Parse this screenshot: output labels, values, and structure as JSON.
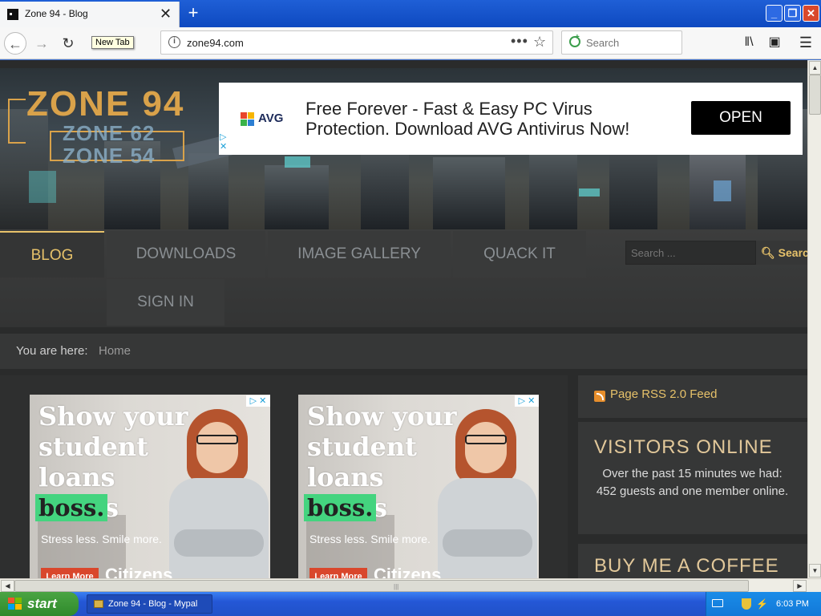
{
  "browser": {
    "tab_title": "Zone 94 - Blog",
    "tooltip": "New Tab",
    "url": "zone94.com",
    "search_placeholder": "Search"
  },
  "site": {
    "logo_main": "ZONE 94",
    "logo_sub1": "ZONE 62",
    "logo_sub2": "ZONE 54",
    "menu": [
      "BLOG",
      "DOWNLOADS",
      "IMAGE GALLERY",
      "QUACK IT",
      "SIGN IN"
    ],
    "active_menu": "BLOG",
    "search_placeholder": "Search ...",
    "search_button": "Search",
    "breadcrumb_label": "You are here:",
    "breadcrumb_home": "Home"
  },
  "top_ad": {
    "brand": "AVG",
    "text": "Free Forever - Fast & Easy PC Virus Protection. Download AVG Antivirus Now!",
    "button": "OPEN"
  },
  "student_ad": {
    "headline": "Show your student loans who's",
    "highlight": "boss.",
    "subline": "Stress less. Smile more.",
    "cta": "Learn More",
    "brand": "Citizens"
  },
  "sidebar": {
    "rss_label": "Page RSS 2.0 Feed",
    "visitors_title": "VISITORS ONLINE",
    "visitors_text": "Over the past 15 minutes we had: 452 guests and one member online.",
    "coffee_title": "BUY ME A COFFEE"
  },
  "taskbar": {
    "start_label": "start",
    "task_label": "Zone 94 - Blog - Mypal",
    "clock": "6:03 PM"
  },
  "colors": {
    "accent_gold": "#e7c26a",
    "page_bg": "#2a2b2b",
    "xp_blue": "#2457d6"
  }
}
